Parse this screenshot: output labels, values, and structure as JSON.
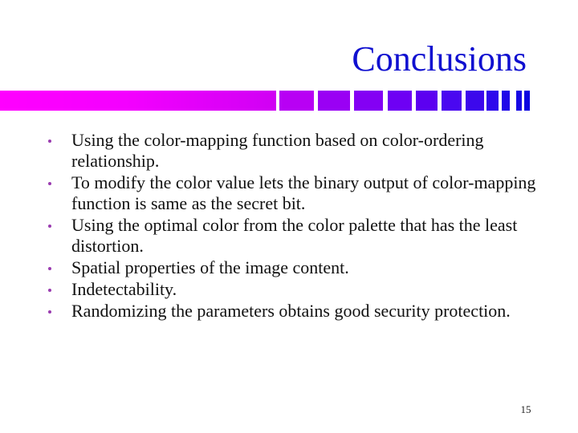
{
  "slide": {
    "title": "Conclusions",
    "title_color": "#1010d0",
    "page_number": "15"
  },
  "decoration": {
    "bar_start_color": "#ff00ff",
    "bar_end_color": "#0000e0",
    "segment_colors": [
      "#b800f4",
      "#9a00f4",
      "#8400f4",
      "#6e00f4",
      "#5c00f0",
      "#4a08f0",
      "#3c08ec",
      "#2e08ec",
      "#2008e8",
      "#1608e4",
      "#0c04e0",
      "#0000dc"
    ]
  },
  "bullets": [
    {
      "text": "Using the color-mapping function based on color-ordering relationship."
    },
    {
      "text": "To modify the color value lets the binary output of color-mapping function is same as the secret bit."
    },
    {
      "text": "Using the optimal color from the color palette that has the least distortion."
    },
    {
      "text": "Spatial properties of the image content."
    },
    {
      "text": "Indetectability."
    },
    {
      "text": "Randomizing the parameters obtains good security protection."
    }
  ],
  "bullet_color": "#9a3cb0"
}
